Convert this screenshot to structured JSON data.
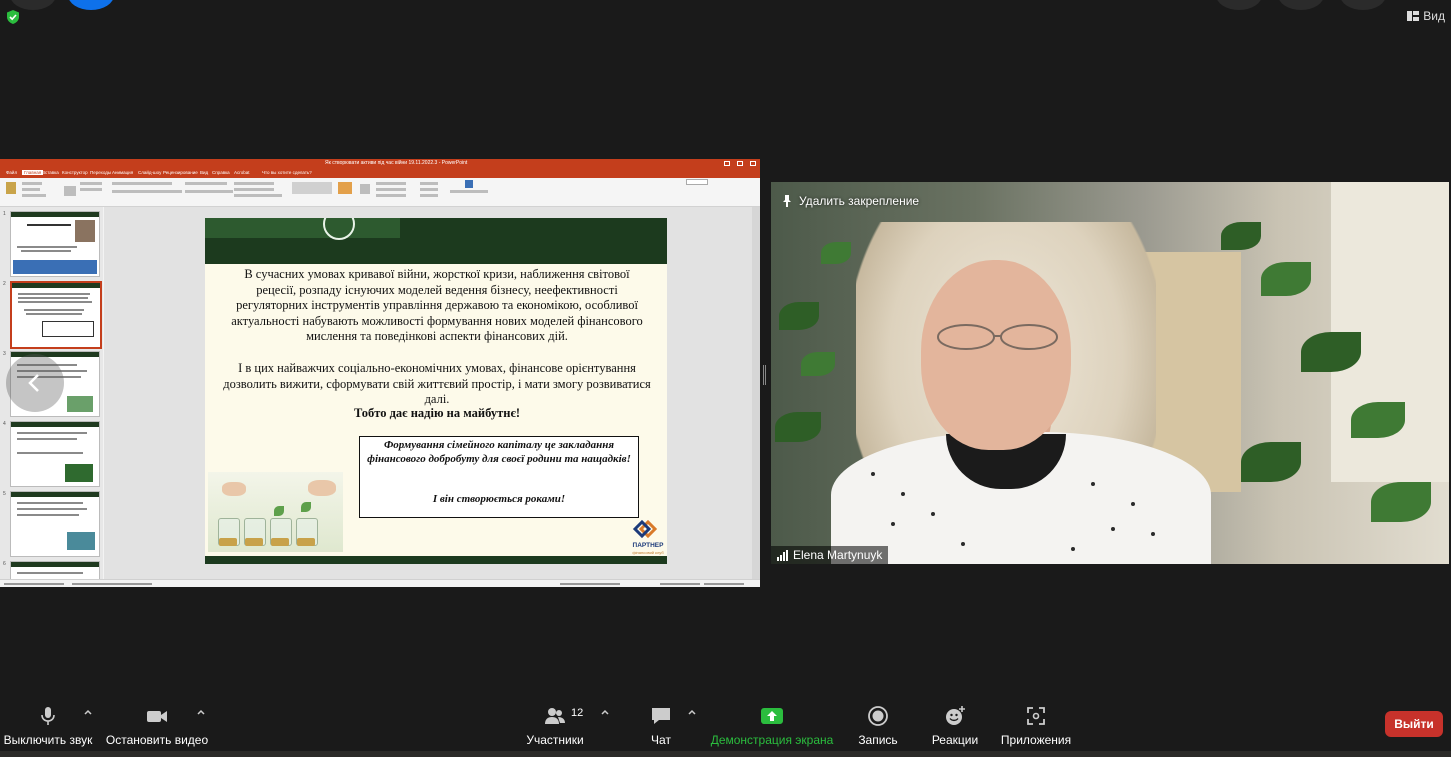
{
  "top": {
    "view_label": "Вид"
  },
  "ppt": {
    "window_title": "Як створювати активи під час війни 19.11.2022.3 - PowerPoint",
    "menu": [
      "Файл",
      "Главная",
      "Вставка",
      "Конструктор",
      "Переходы",
      "Анимация",
      "Слайд-шоу",
      "Рецензирование",
      "Вид",
      "Справка",
      "Acrobat",
      "Что вы хотите сделать?"
    ],
    "share_label": "Общий доступ"
  },
  "slide": {
    "paragraph1": "В сучасних умовах кривавої війни, жорсткої кризи, наближення світової рецесії, розпаду існуючих моделей ведення бізнесу, неефективності регуляторних інструментів управління державою та економікою, особливої актуальності набувають можливості формування нових моделей фінансового мислення та поведінкові аспекти фінансових дій.",
    "paragraph2": "І в цих найважчих соціально-економічних умовах, фінансове орієнтування  дозволить вижити, сформувати свій життєвий простір, і мати змогу розвиватися далі.",
    "paragraph3": "Тобто дає надію на майбутнє!",
    "quote_line1": "Формування сімейного капіталу це закладання фінансового добробуту для своєї родини та нащадків!",
    "quote_line2": "І він створюється роками!",
    "logo_text": "ПАРТНЕР",
    "logo_sub": "фінансовий клуб"
  },
  "thumbs": {
    "numbers": [
      "1",
      "2",
      "3",
      "4",
      "5",
      "6"
    ],
    "slide1_title": "Мартинюк Олена",
    "slide1_subtitle": "Фінансові можливості та активи під час війни"
  },
  "video": {
    "unpin_label": "Удалить закрепление",
    "participant_name": "Elena Martynuyk"
  },
  "toolbar": {
    "mute_label": "Выключить звук",
    "video_label": "Остановить видео",
    "participants_label": "Участники",
    "participants_count": "12",
    "chat_label": "Чат",
    "share_label": "Демонстрация экрана",
    "record_label": "Запись",
    "reactions_label": "Реакции",
    "apps_label": "Приложения",
    "leave_label": "Выйти"
  },
  "colors": {
    "ppt_accent": "#c43e1c",
    "share_green": "#2bbd3e",
    "leave_red": "#c7322b",
    "slide_green": "#1c3a1e"
  }
}
